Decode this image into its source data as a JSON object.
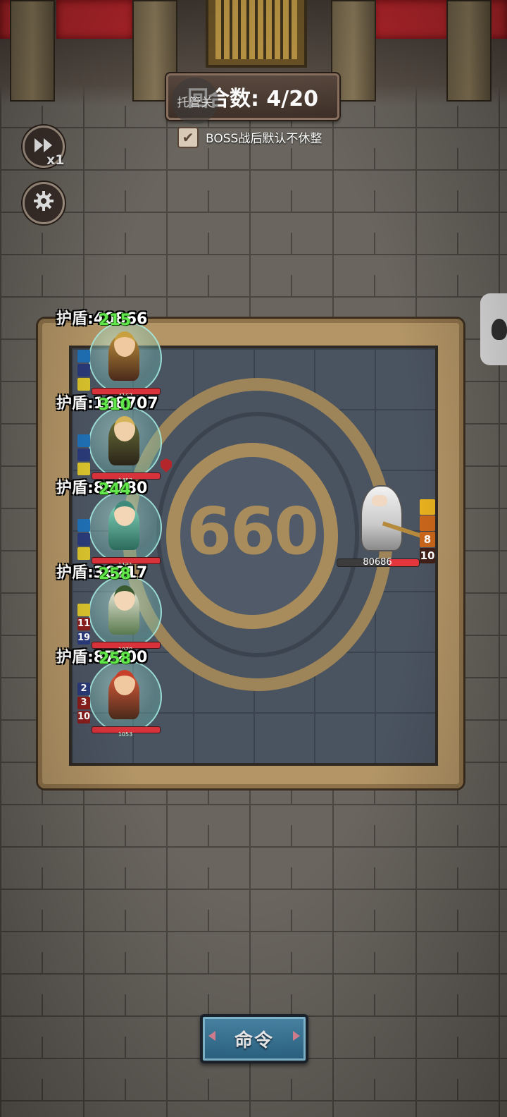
{
  "hud": {
    "round_text": "回合数: 4/20",
    "auto_label": "托管关",
    "boss_rest_checkbox_label": "BOSS战后默认不休整",
    "boss_rest_checked": true,
    "speed_label": "x1"
  },
  "arena": {
    "center_number": "660"
  },
  "heroes": [
    {
      "shield": "护盾:40866",
      "heal": "215",
      "hp": "4167",
      "badges": []
    },
    {
      "shield": "护盾:168707",
      "heal": "310",
      "hp": "1453",
      "badges": []
    },
    {
      "shield": "护盾:85180",
      "heal": "244",
      "hp": "1121",
      "badges": []
    },
    {
      "shield": "护盾:36217",
      "heal": "258",
      "hp": "1078",
      "badges": [
        "11",
        "19"
      ]
    },
    {
      "shield": "护盾:87200",
      "heal": "258",
      "hp": "1053",
      "badges": [
        "2",
        "3",
        "10"
      ]
    }
  ],
  "enemy": {
    "hp": "80686",
    "hp_fraction": 0.36,
    "buffs": [
      "8",
      "10"
    ]
  },
  "actions": {
    "command_label": "命令"
  },
  "icons": [
    "fast-forward-icon",
    "gear-icon",
    "checkmark-icon",
    "boss-marker-icon"
  ],
  "colors": {
    "heal_green": "#62e84a",
    "hp_red": "#d8333a",
    "command_blue": "#3d7ea2"
  }
}
